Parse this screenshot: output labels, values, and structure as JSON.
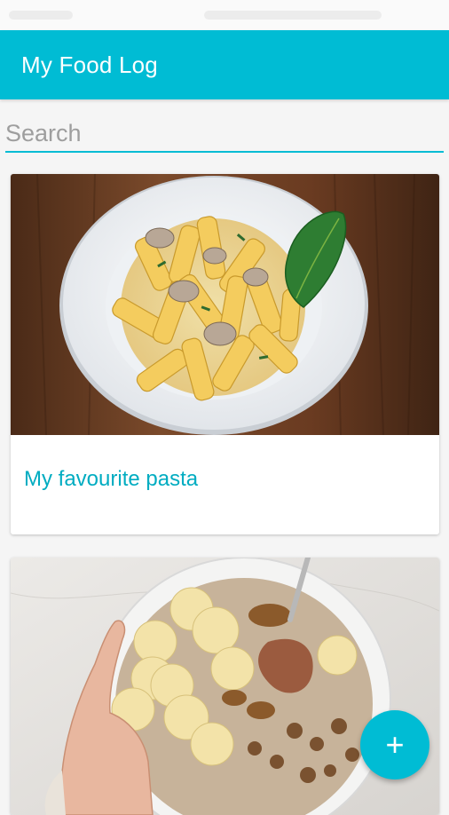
{
  "app_bar": {
    "title": "My Food Log",
    "color": "#00bcd4"
  },
  "search": {
    "placeholder": "Search",
    "value": ""
  },
  "cards": [
    {
      "title": "My favourite pasta",
      "image_icon": "pasta-photo"
    },
    {
      "title": "",
      "image_icon": "oatmeal-bowl-photo"
    }
  ],
  "fab": {
    "label": "+",
    "icon": "plus-icon"
  }
}
